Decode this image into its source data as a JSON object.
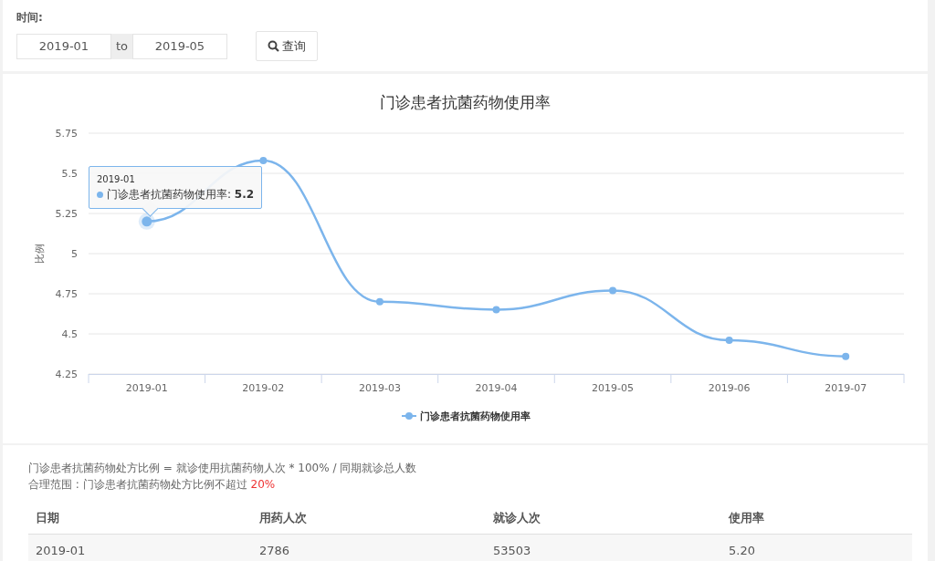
{
  "filter": {
    "label": "时间:",
    "from": "2019-01",
    "separator": "to",
    "to": "2019-05",
    "button": "查询"
  },
  "chart": {
    "title": "门诊患者抗菌药物使用率",
    "chart_data": {
      "type": "line",
      "ylabel": "比例",
      "categories": [
        "2019-01",
        "2019-02",
        "2019-03",
        "2019-04",
        "2019-05",
        "2019-06",
        "2019-07"
      ],
      "grid": true,
      "series": [
        {
          "name": "门诊患者抗菌药物使用率",
          "color": "#7cb5ec",
          "marker": true,
          "values": [
            5.2,
            5.58,
            4.7,
            4.65,
            4.77,
            4.46,
            4.36
          ]
        }
      ],
      "ylim": [
        4.25,
        5.75
      ],
      "yticks": [
        4.25,
        4.5,
        4.75,
        5,
        5.25,
        5.5,
        5.75
      ]
    },
    "tooltip": {
      "category": "2019-01",
      "text": "门诊患者抗菌药物使用率: **5.2**"
    }
  },
  "notes": {
    "formula": "门诊患者抗菌药物处方比例 = 就诊使用抗菌药物人次 * 100% / 同期就诊总人数",
    "range_label": "合理范围 : 门诊患者抗菌药物处方比例不超过",
    "range_value": "20%"
  },
  "table": {
    "columns": [
      "日期",
      "用药人次",
      "就诊人次",
      "使用率"
    ],
    "rows": [
      [
        "2019-01",
        "2786",
        "53503",
        "5.20"
      ]
    ]
  }
}
